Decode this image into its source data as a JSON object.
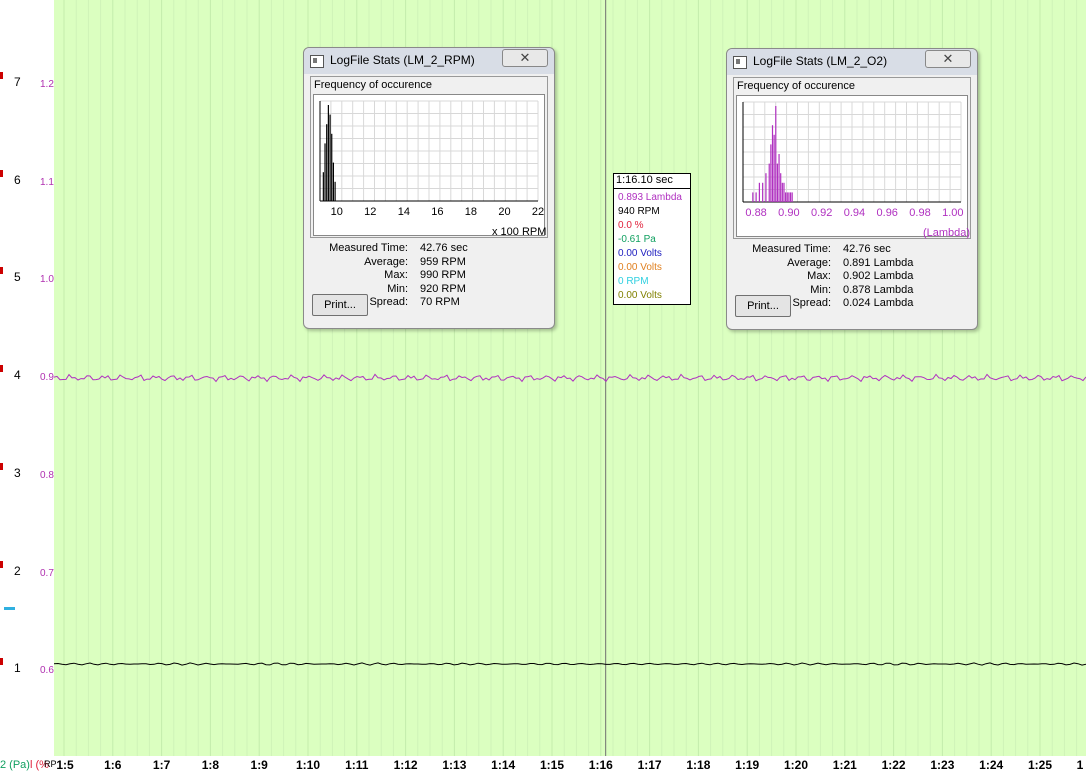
{
  "y_axis": {
    "rpm_ticks": [
      "7",
      "6",
      "5",
      "4",
      "3",
      "2",
      "1"
    ],
    "lambda_ticks": [
      "1.2",
      "1.1",
      "1.0",
      "0.9",
      "0.8",
      "0.7",
      "0.6"
    ]
  },
  "x_axis": {
    "ticks": [
      "1:5",
      "1:6",
      "1:7",
      "1:8",
      "1:9",
      "1:10",
      "1:11",
      "1:12",
      "1:13",
      "1:14",
      "1:15",
      "1:16",
      "1:17",
      "1:18",
      "1:19",
      "1:20",
      "1:21",
      "1:22",
      "1:23",
      "1:24",
      "1:25",
      "1"
    ],
    "left_labels": {
      "pa": "2 (Pa)",
      "pct": "l (%",
      "rp": "RP"
    }
  },
  "cursor": {
    "time": "1:16.10 sec",
    "rows": [
      {
        "text": "0.893 Lambda",
        "color": "#b030c0"
      },
      {
        "text": "940 RPM",
        "color": "#000000"
      },
      {
        "text": "0.0 %",
        "color": "#e0203a"
      },
      {
        "text": "-0.61 Pa",
        "color": "#10a060"
      },
      {
        "text": "0.00 Volts",
        "color": "#2020c0"
      },
      {
        "text": "0.00 Volts",
        "color": "#e08020"
      },
      {
        "text": "0 RPM",
        "color": "#30d0e0"
      },
      {
        "text": "0.00 Volts",
        "color": "#808000"
      }
    ]
  },
  "rpm_window": {
    "title": "LogFile Stats (LM_2_RPM)",
    "close_glyph": "✕",
    "freq_label": "Frequency of occurence",
    "x_ticks": [
      "10",
      "12",
      "14",
      "16",
      "18",
      "20",
      "22"
    ],
    "x_unit": "x 100 RPM",
    "stats": [
      {
        "label": "Measured Time:",
        "value": "42.76 sec"
      },
      {
        "label": "Average:",
        "value": "959 RPM"
      },
      {
        "label": "Max:",
        "value": "990 RPM"
      },
      {
        "label": "Min:",
        "value": "920 RPM"
      },
      {
        "label": "Spread:",
        "value": "70 RPM"
      }
    ],
    "print_label": "Print..."
  },
  "o2_window": {
    "title": "LogFile Stats (LM_2_O2)",
    "close_glyph": "✕",
    "freq_label": "Frequency of occurence",
    "x_ticks": [
      "0.88",
      "0.90",
      "0.92",
      "0.94",
      "0.96",
      "0.98",
      "1.00"
    ],
    "x_unit": "(Lambda)",
    "stats": [
      {
        "label": "Measured Time:",
        "value": "42.76 sec"
      },
      {
        "label": "Average:",
        "value": "0.891 Lambda"
      },
      {
        "label": "Max:",
        "value": "0.902 Lambda"
      },
      {
        "label": "Min:",
        "value": "0.878 Lambda"
      },
      {
        "label": "Spread:",
        "value": "0.024 Lambda"
      }
    ],
    "print_label": "Print..."
  },
  "colors": {
    "plot_bg": "#dbffc0",
    "lambda_trace": "#b030c0",
    "rpm_trace": "#000000"
  },
  "chart_data": [
    {
      "type": "line",
      "series": [
        {
          "name": "Lambda",
          "x_range_sec": [
            65,
            86
          ],
          "approx_value": 0.893
        },
        {
          "name": "RPM",
          "x_range_sec": [
            65,
            86
          ],
          "approx_value": 940
        }
      ],
      "x_ticks": [
        "1:5",
        "1:6",
        "1:7",
        "1:8",
        "1:9",
        "1:10",
        "1:11",
        "1:12",
        "1:13",
        "1:14",
        "1:15",
        "1:16",
        "1:17",
        "1:18",
        "1:19",
        "1:20",
        "1:21",
        "1:22",
        "1:23",
        "1:24",
        "1:25"
      ],
      "ylim_lambda": [
        0.5,
        1.3
      ],
      "ylim_rpm_x1000": [
        0,
        8
      ],
      "grid": true
    },
    {
      "type": "bar",
      "title": "Frequency of occurence",
      "x": [
        9.2,
        9.3,
        9.4,
        9.5,
        9.6,
        9.7,
        9.8,
        9.9
      ],
      "values": [
        3,
        6,
        8,
        10,
        9,
        7,
        4,
        2
      ],
      "xlim": [
        9,
        22
      ],
      "xlabel": "x 100 RPM"
    },
    {
      "type": "bar",
      "title": "Frequency of occurence",
      "x": [
        0.878,
        0.88,
        0.882,
        0.884,
        0.886,
        0.888,
        0.889,
        0.89,
        0.891,
        0.892,
        0.893,
        0.894,
        0.895,
        0.896,
        0.897,
        0.898,
        0.899,
        0.9,
        0.901,
        0.902
      ],
      "values": [
        1,
        1,
        2,
        2,
        3,
        4,
        6,
        8,
        7,
        10,
        4,
        5,
        3,
        2,
        2,
        1,
        1,
        1,
        1,
        1
      ],
      "xlim": [
        0.87,
        1.01
      ],
      "xlabel": "(Lambda)"
    }
  ]
}
